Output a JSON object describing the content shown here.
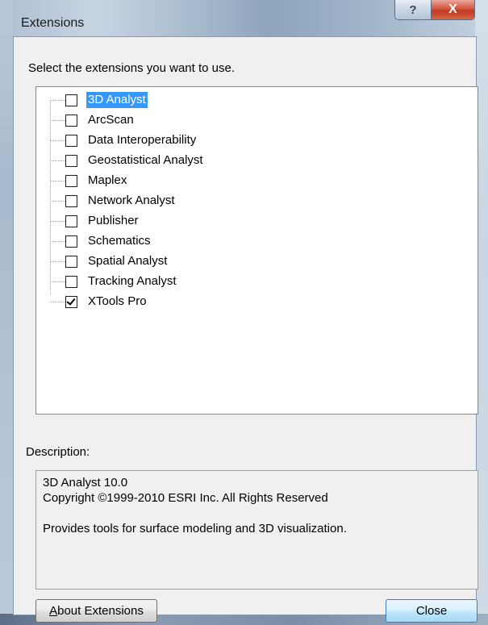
{
  "window": {
    "title": "Extensions",
    "help_glyph": "?",
    "close_glyph": "X"
  },
  "instruction": "Select the extensions you want to use.",
  "extensions": [
    {
      "label": "3D Analyst",
      "checked": false,
      "selected": true
    },
    {
      "label": "ArcScan",
      "checked": false,
      "selected": false
    },
    {
      "label": "Data Interoperability",
      "checked": false,
      "selected": false
    },
    {
      "label": "Geostatistical Analyst",
      "checked": false,
      "selected": false
    },
    {
      "label": "Maplex",
      "checked": false,
      "selected": false
    },
    {
      "label": "Network Analyst",
      "checked": false,
      "selected": false
    },
    {
      "label": "Publisher",
      "checked": false,
      "selected": false
    },
    {
      "label": "Schematics",
      "checked": false,
      "selected": false
    },
    {
      "label": "Spatial Analyst",
      "checked": false,
      "selected": false
    },
    {
      "label": "Tracking Analyst",
      "checked": false,
      "selected": false
    },
    {
      "label": "XTools Pro",
      "checked": true,
      "selected": false
    }
  ],
  "description": {
    "title": "Description:",
    "line1": "3D Analyst 10.0",
    "line2": "Copyright ©1999-2010 ESRI Inc. All Rights Reserved",
    "line3": "Provides tools for surface modeling and 3D visualization."
  },
  "buttons": {
    "about_first": "A",
    "about_rest": "bout Extensions",
    "close": "Close"
  },
  "colors": {
    "selection": "#3399ff",
    "dialog_bg": "#f0f0f0"
  }
}
